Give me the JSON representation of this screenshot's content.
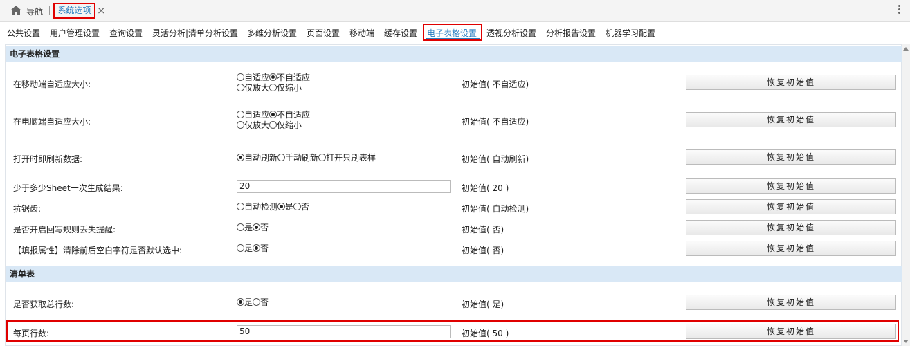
{
  "header": {
    "home_icon": "home-icon",
    "nav_label": "导航",
    "active_tab": "系统选项",
    "close_symbol": "×"
  },
  "tabs": [
    {
      "label": "公共设置"
    },
    {
      "label": "用户管理设置"
    },
    {
      "label": "查询设置"
    },
    {
      "label": "灵活分析|清单分析设置"
    },
    {
      "label": "多维分析设置"
    },
    {
      "label": "页面设置"
    },
    {
      "label": "移动端"
    },
    {
      "label": "缓存设置"
    },
    {
      "label": "电子表格设置",
      "active": true
    },
    {
      "label": "透视分析设置"
    },
    {
      "label": "分析报告设置"
    },
    {
      "label": "机器学习配置"
    }
  ],
  "sections": {
    "spreadsheet": "电子表格设置",
    "list": "清单表"
  },
  "reset_label": "恢复初始值",
  "rows": [
    {
      "label": "在移动端自适应大小:",
      "options_line1": [
        "自适应",
        "不自适应"
      ],
      "options_line2": [
        "仅放大",
        "仅缩小"
      ],
      "selected": "不自适应",
      "default": "初始值( 不自适应)"
    },
    {
      "label": "在电脑端自适应大小:",
      "options_line1": [
        "自适应",
        "不自适应"
      ],
      "options_line2": [
        "仅放大",
        "仅缩小"
      ],
      "selected": "不自适应",
      "default": "初始值( 不自适应)"
    },
    {
      "label": "打开时即刷新数据:",
      "options": [
        "自动刷新",
        "手动刷新",
        "打开只刷表样"
      ],
      "selected": "自动刷新",
      "default": "初始值( 自动刷新)"
    },
    {
      "label": "少于多少Sheet一次生成结果:",
      "value": "20",
      "default": "初始值( 20 )"
    },
    {
      "label": "抗锯齿:",
      "options": [
        "自动检测",
        "是",
        "否"
      ],
      "selected": "是",
      "default": "初始值( 自动检测)"
    },
    {
      "label": "是否开启回写规则丢失提醒:",
      "options": [
        "是",
        "否"
      ],
      "selected": "否",
      "default": "初始值( 否)"
    },
    {
      "label": "【填报属性】清除前后空白字符是否默认选中:",
      "options": [
        "是",
        "否"
      ],
      "selected": "否",
      "default": "初始值( 否)"
    },
    {
      "label": "是否获取总行数:",
      "options": [
        "是",
        "否"
      ],
      "selected": "是",
      "default": "初始值( 是)"
    },
    {
      "label": "每页行数:",
      "value": "50",
      "default": "初始值( 50 )"
    }
  ],
  "colors": {
    "accent": "#2a7fc1",
    "highlight": "#e00000",
    "section_bg": "#d9e8f6"
  }
}
